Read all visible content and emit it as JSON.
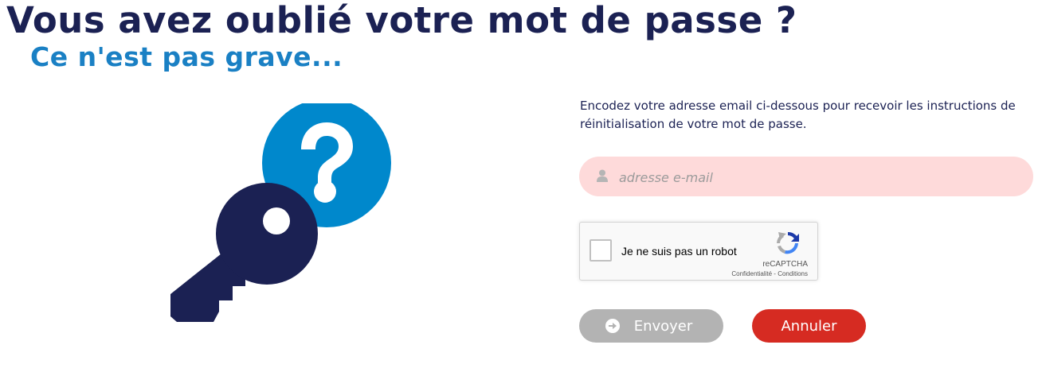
{
  "header": {
    "title": "Vous avez oublié votre mot de passe ?",
    "subtitle": "Ce n'est pas grave..."
  },
  "illustration": {
    "icon_name": "key-question-icon",
    "colors": {
      "key": "#1b2153",
      "bubble": "#0088cc"
    }
  },
  "form": {
    "instructions": "Encodez votre adresse email ci-dessous pour recevoir les instructions de réinitialisation de votre mot de passe.",
    "email": {
      "placeholder": "adresse e-mail",
      "value": "",
      "icon": "user-icon",
      "background": "#fedada"
    },
    "recaptcha": {
      "label": "Je ne suis pas un robot",
      "brand": "reCAPTCHA",
      "privacy": "Confidentialité",
      "separator": " - ",
      "terms": "Conditions"
    },
    "buttons": {
      "send": {
        "label": "Envoyer",
        "icon": "arrow-circle-right-icon",
        "color": "#b3b3b3"
      },
      "cancel": {
        "label": "Annuler",
        "color": "#d62b22"
      }
    }
  },
  "colors": {
    "navy": "#1b2153",
    "blue": "#1a80c4"
  }
}
